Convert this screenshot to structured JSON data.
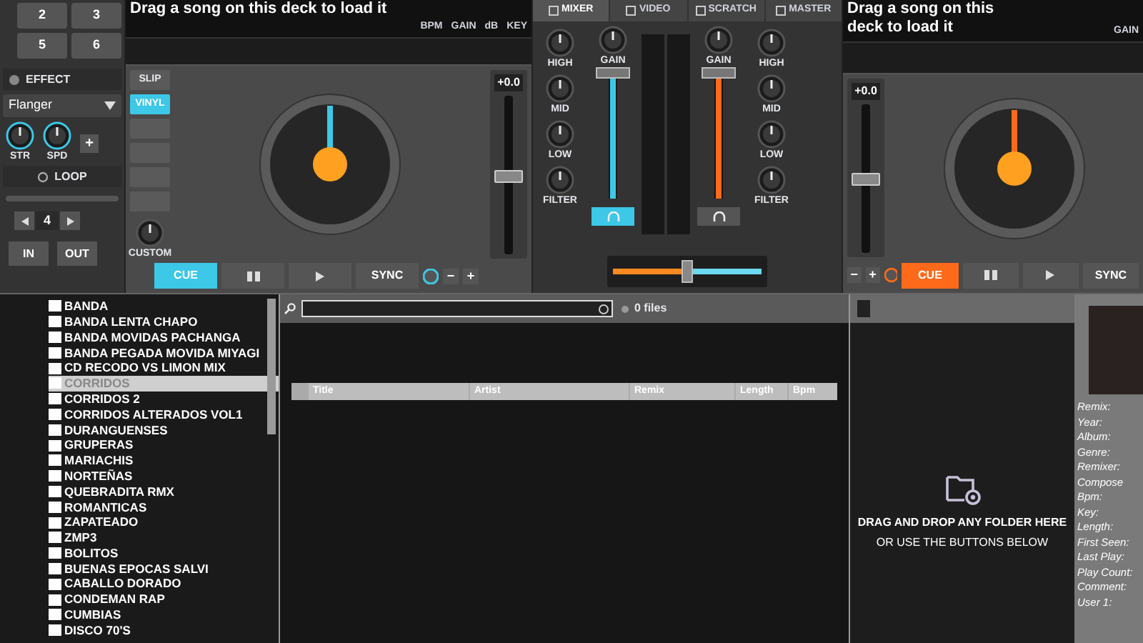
{
  "left_panel": {
    "pads": [
      "2",
      "3",
      "5",
      "6"
    ],
    "effect": {
      "title": "EFFECT",
      "selected": "Flanger",
      "knobs": [
        "STR",
        "SPD"
      ],
      "add": "+"
    },
    "loop": {
      "title": "LOOP",
      "size": "4",
      "in": "IN",
      "out": "OUT"
    }
  },
  "decks": [
    {
      "prompt": "Drag a song on this deck to load it",
      "color": "#3cc8e6",
      "info": [
        "BPM",
        "GAIN",
        "dB",
        "KEY"
      ],
      "modes": [
        {
          "label": "SLIP",
          "selected": false
        },
        {
          "label": "VINYL",
          "selected": true
        }
      ],
      "custom": "CUSTOM",
      "pitch": {
        "reading": "+0.0",
        "level": 0.5
      },
      "cue": {
        "label": "CUE",
        "active": true
      },
      "sync": "SYNC",
      "minus": "−",
      "plus": "+"
    },
    {
      "prompt": "Drag a song on this deck to load it",
      "color": "#ff6a1a",
      "info": [
        "GAIN"
      ],
      "pitch": {
        "reading": "+0.0",
        "level": 0.5
      },
      "cue": {
        "label": "CUE",
        "active": true
      },
      "sync": "SYNC",
      "minus": "−",
      "plus": "+"
    }
  ],
  "mixer": {
    "tabs": [
      {
        "label": "MIXER",
        "selected": true
      },
      {
        "label": "VIDEO",
        "selected": false
      },
      {
        "label": "SCRATCH",
        "selected": false
      },
      {
        "label": "MASTER",
        "selected": false
      }
    ],
    "eq_left": [
      "HIGH",
      "MID",
      "LOW",
      "FILTER"
    ],
    "eq_right": [
      "HIGH",
      "MID",
      "LOW",
      "FILTER"
    ],
    "channels": [
      {
        "gain": "GAIN",
        "level": 1,
        "pfl": true
      },
      {
        "gain": "GAIN",
        "level": 1,
        "pfl": false
      }
    ],
    "crossfader": {
      "level": 0.5
    }
  },
  "browser": {
    "tree": [
      {
        "label": "BANDA",
        "selected": false
      },
      {
        "label": "BANDA LENTA CHAPO",
        "selected": false
      },
      {
        "label": "BANDA MOVIDAS PACHANGA",
        "selected": false
      },
      {
        "label": "BANDA PEGADA MOVIDA MIYAGI",
        "selected": false
      },
      {
        "label": "CD RECODO VS LIMON MIX",
        "selected": false
      },
      {
        "label": "CORRIDOS",
        "selected": true
      },
      {
        "label": "CORRIDOS 2",
        "selected": false
      },
      {
        "label": "CORRIDOS ALTERADOS VOL1",
        "selected": false
      },
      {
        "label": "DURANGUENSES",
        "selected": false
      },
      {
        "label": "GRUPERAS",
        "selected": false
      },
      {
        "label": "MARIACHIS",
        "selected": false
      },
      {
        "label": "NORTEÑAS",
        "selected": false
      },
      {
        "label": "QUEBRADITA RMX",
        "selected": false
      },
      {
        "label": "ROMANTICAS",
        "selected": false
      },
      {
        "label": "ZAPATEADO",
        "selected": false
      },
      {
        "label": "ZMP3",
        "selected": false
      },
      {
        "label": "BOLITOS",
        "selected": false
      },
      {
        "label": "BUENAS EPOCAS SALVI",
        "selected": false
      },
      {
        "label": "CABALLO DORADO",
        "selected": false
      },
      {
        "label": "CONDEMAN RAP",
        "selected": false
      },
      {
        "label": "CUMBIAS",
        "selected": false
      },
      {
        "label": "DISCO 70'S",
        "selected": false
      }
    ],
    "file_count": "0 files",
    "columns": [
      "Title",
      "Artist",
      "Remix",
      "Length",
      "Bpm"
    ],
    "drop_hint": [
      "DRAG AND DROP ANY FOLDER HERE",
      "OR USE THE BUTTONS BELOW"
    ],
    "info_labels": [
      "Remix:",
      "Year:",
      "Album:",
      "Genre:",
      "Remixer:",
      "Compose",
      "Bpm:",
      "Key:",
      "Length:",
      "First Seen:",
      "Last Play:",
      "Play Count:",
      "Comment:",
      "User 1:"
    ]
  }
}
